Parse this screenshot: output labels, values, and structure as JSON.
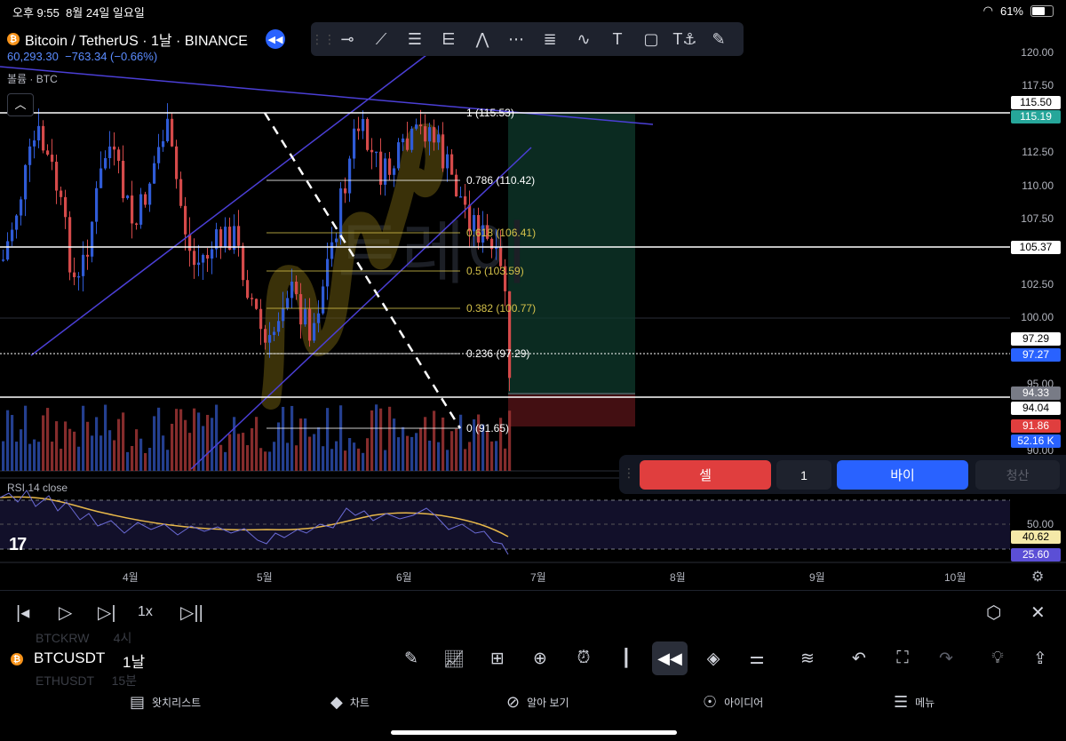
{
  "status": {
    "time": "오후 9:55",
    "date": "8월 24일 일요일",
    "battery": "61%"
  },
  "symbol": {
    "name": "Bitcoin / TetherUS · 1날 · BINANCE",
    "price": "60,293.30",
    "change": "−763.34 (−0.66%)"
  },
  "volume_label": "볼륨 · BTC",
  "drawing_tools": [
    "horizontal-ray-icon",
    "trend-line-icon",
    "parallel-channel-icon",
    "pitchfork-icon",
    "abcd-pattern-icon",
    "xabcd-pattern-icon",
    "fib-retracement-icon",
    "elliott-wave-icon",
    "text-icon",
    "rectangle-icon",
    "text-anchor-icon",
    "brush-icon"
  ],
  "yaxis": [
    "120.00",
    "117.50",
    "112.50",
    "110.00",
    "107.50",
    "102.50",
    "100.00",
    "95.00",
    "90.00"
  ],
  "price_tags": [
    {
      "label": "115.50",
      "bg": "#ffffff",
      "fg": "#000000"
    },
    {
      "label": "115.19",
      "bg": "#26a69a",
      "fg": "#ffffff"
    },
    {
      "label": "105.37",
      "bg": "#ffffff",
      "fg": "#000000"
    },
    {
      "label": "97.29",
      "bg": "#ffffff",
      "fg": "#000000"
    },
    {
      "label": "97.27",
      "bg": "#2962ff",
      "fg": "#ffffff"
    },
    {
      "label": "94.33",
      "bg": "#787b86",
      "fg": "#ffffff"
    },
    {
      "label": "94.04",
      "bg": "#ffffff",
      "fg": "#000000"
    },
    {
      "label": "91.86",
      "bg": "#e03e3e",
      "fg": "#ffffff"
    },
    {
      "label": "52.16 K",
      "bg": "#2962ff",
      "fg": "#ffffff"
    }
  ],
  "fib_levels": [
    {
      "label": "1 (115.53)",
      "color": "#ffffff"
    },
    {
      "label": "0.786 (110.42)",
      "color": "#ffffff"
    },
    {
      "label": "0.618 (106.41)",
      "color": "#d4c14a"
    },
    {
      "label": "0.5 (103.59)",
      "color": "#d4c14a"
    },
    {
      "label": "0.382 (100.77)",
      "color": "#d4c14a"
    },
    {
      "label": "0.236 (97.29)",
      "color": "#ffffff"
    },
    {
      "label": "0 (91.65)",
      "color": "#ffffff"
    }
  ],
  "watermark": "트레이",
  "trade": {
    "sell": "셀",
    "qty": "1",
    "buy": "바이",
    "close": "청산"
  },
  "rsi": {
    "label": "RSI 14 close",
    "level": "50.00",
    "value1": "40.62",
    "value2": "25.60"
  },
  "xaxis": [
    "4월",
    "5월",
    "6월",
    "7월",
    "8월",
    "9월",
    "10월"
  ],
  "bottom": {
    "symbol": "BTCUSDT",
    "interval": "1날",
    "ghost1": "BTCKRW",
    "ghost1b": "4시",
    "ghost2": "ETHUSDT",
    "ghost2b": "15분",
    "speed": "1x"
  },
  "tabs": [
    {
      "label": "왓치리스트",
      "icon": "watchlist-icon"
    },
    {
      "label": "차트",
      "icon": "chart-icon"
    },
    {
      "label": "알아 보기",
      "icon": "compass-icon"
    },
    {
      "label": "아이디어",
      "icon": "idea-icon"
    },
    {
      "label": "메뉴",
      "icon": "menu-icon"
    }
  ]
}
